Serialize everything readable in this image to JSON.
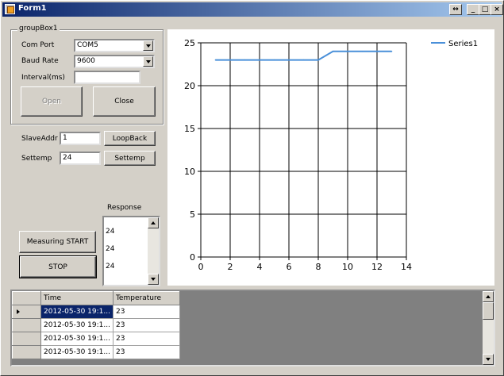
{
  "window": {
    "title": "Form1"
  },
  "group": {
    "title": "groupBox1",
    "com_port_label": "Com Port",
    "com_port_value": "COM5",
    "baud_rate_label": "Baud Rate",
    "baud_rate_value": "9600",
    "interval_label": "Interval(ms)",
    "interval_value": "",
    "open_label": "Open",
    "close_label": "Close"
  },
  "slave": {
    "label": "SlaveAddr",
    "value": "1",
    "button": "LoopBack"
  },
  "settemp": {
    "label": "Settemp",
    "value": "24",
    "button": "Settemp"
  },
  "response": {
    "label": "Response",
    "items": [
      "24",
      "24",
      "24"
    ]
  },
  "measure": {
    "start_label": "Measuring START",
    "stop_label": "STOP"
  },
  "chart_data": {
    "type": "line",
    "series": [
      {
        "name": "Series1",
        "x": [
          1,
          2,
          3,
          4,
          5,
          6,
          7,
          8,
          9,
          10,
          11,
          12,
          13
        ],
        "y": [
          23,
          23,
          23,
          23,
          23,
          23,
          23,
          23,
          24,
          24,
          24,
          24,
          24
        ],
        "color": "#4a90d9"
      }
    ],
    "xlim": [
      0,
      14
    ],
    "ylim": [
      0,
      25
    ],
    "xticks": [
      "0",
      "2",
      "4",
      "6",
      "8",
      "10",
      "12",
      "14"
    ],
    "yticks": [
      "0",
      "5",
      "10",
      "15",
      "20",
      "25"
    ],
    "grid": true,
    "legend": "top-right"
  },
  "grid": {
    "headers": [
      "Time",
      "Temperature"
    ],
    "rows": [
      {
        "time": "2012-05-30 19:1...",
        "temp": "23"
      },
      {
        "time": "2012-05-30 19:1...",
        "temp": "23"
      },
      {
        "time": "2012-05-30 19:1...",
        "temp": "23"
      },
      {
        "time": "2012-05-30 19:1...",
        "temp": "23"
      }
    ]
  }
}
